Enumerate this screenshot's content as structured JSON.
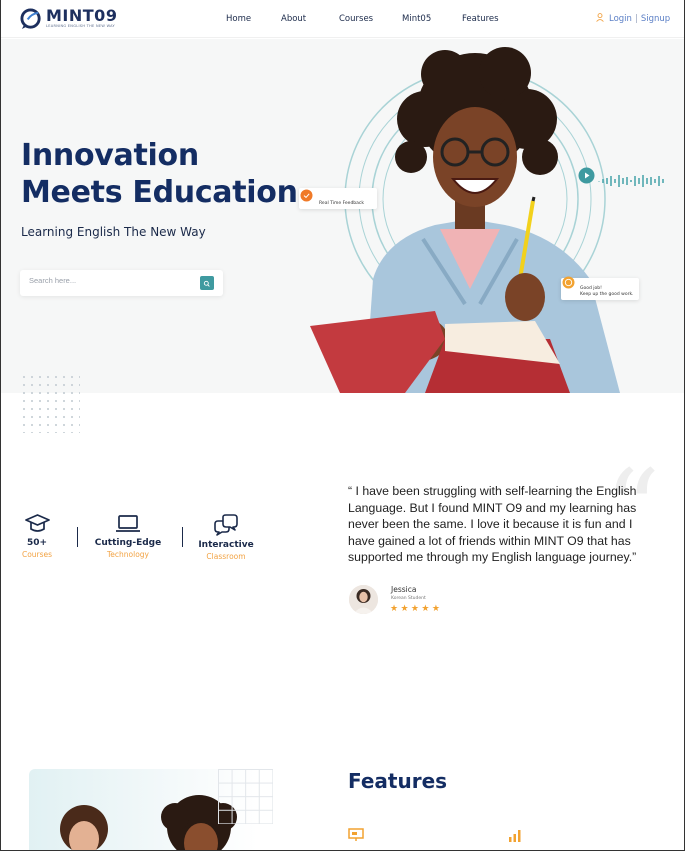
{
  "brand": {
    "name": "MINT09",
    "tagline": "LEARNING ENGLISH THE NEW WAY",
    "colors": {
      "navy": "#142d63",
      "orange": "#f2a344",
      "teal": "#3f9aa0",
      "link": "#5b7fc6"
    }
  },
  "nav": {
    "items": [
      {
        "label": "Home"
      },
      {
        "label": "About"
      },
      {
        "label": "Courses"
      },
      {
        "label": "Mint05"
      },
      {
        "label": "Features"
      }
    ],
    "login_label": "Login",
    "separator": "|",
    "signup_label": "Signup",
    "user_icon": "user-icon"
  },
  "hero": {
    "title_line1": "Innovation",
    "title_line2": "Meets Education",
    "subtitle": "Learning English The New Way",
    "search": {
      "placeholder": "Search here...",
      "value": "",
      "icon": "search-icon"
    },
    "feedback_chip": "Real Time Feedback",
    "good_job_line1": "Good job!",
    "good_job_line2": "Keep up the good work."
  },
  "stats": [
    {
      "icon": "graduation-cap-icon",
      "title": "50+",
      "subtitle": "Courses"
    },
    {
      "icon": "laptop-icon",
      "title": "Cutting-Edge",
      "subtitle": "Technology"
    },
    {
      "icon": "chat-bubbles-icon",
      "title": "Interactive",
      "subtitle": "Classroom"
    }
  ],
  "testimonial": {
    "quote": "“ I have been struggling with self-learning the English Language. But I found MINT O9 and my learning has never been the same. I love it because it is fun and I have gained a lot of friends within MINT O9 that has supported me through my English language journey.”",
    "name": "Jessica",
    "role": "Korean Student",
    "stars": "★★★★★",
    "rating": 5
  },
  "features": {
    "title": "Features",
    "icons": [
      "presentation-icon",
      "bar-chart-icon"
    ]
  }
}
